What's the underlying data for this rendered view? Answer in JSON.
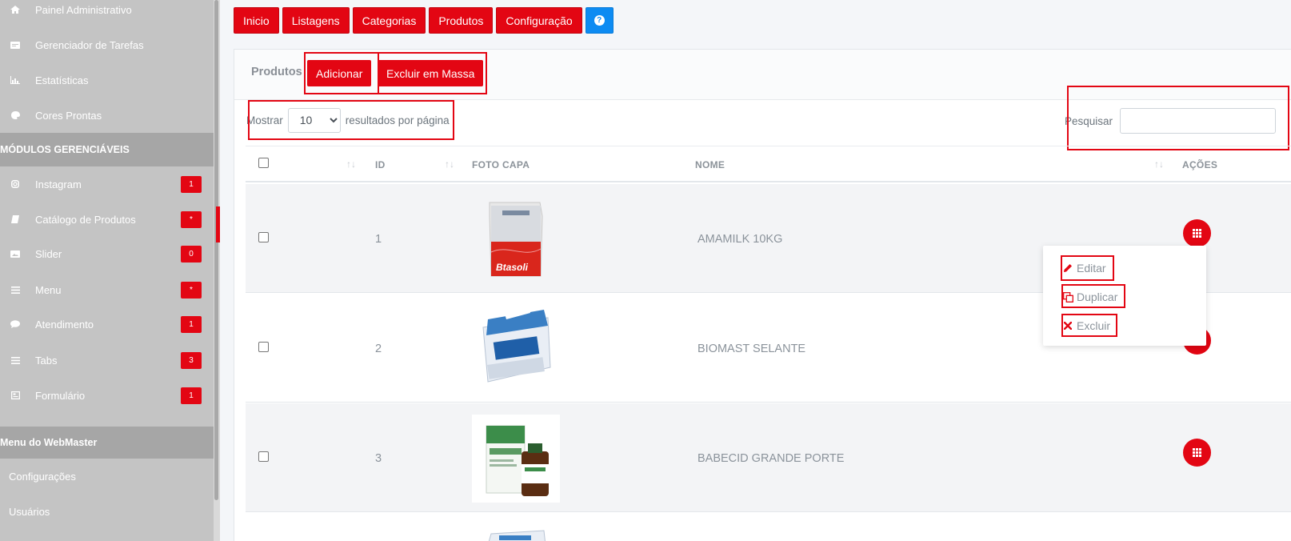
{
  "sidebar": {
    "items": [
      {
        "label": "Painel Administrativo",
        "icon": "home-icon"
      },
      {
        "label": "Gerenciador de Tarefas",
        "icon": "tasks-icon"
      },
      {
        "label": "Estatísticas",
        "icon": "chart-icon"
      },
      {
        "label": "Cores Prontas",
        "icon": "palette-icon"
      }
    ],
    "section_modules": "MÓDULOS GERENCIÁVEIS",
    "modules": [
      {
        "label": "Instagram",
        "badge": "1",
        "icon": "instagram-icon"
      },
      {
        "label": "Catálogo de Produtos",
        "badge": "*",
        "icon": "book-icon"
      },
      {
        "label": "Slider",
        "badge": "0",
        "icon": "image-icon"
      },
      {
        "label": "Menu",
        "badge": "*",
        "icon": "bars-icon"
      },
      {
        "label": "Atendimento",
        "badge": "1",
        "icon": "chat-icon"
      },
      {
        "label": "Tabs",
        "badge": "3",
        "icon": "list-icon"
      },
      {
        "label": "Formulário",
        "badge": "1",
        "icon": "form-icon"
      }
    ],
    "section_webmaster": "Menu do WebMaster",
    "webmaster": [
      {
        "label": "Configurações"
      },
      {
        "label": "Usuários"
      }
    ]
  },
  "topnav": {
    "buttons": [
      "Inicio",
      "Listagens",
      "Categorias",
      "Produtos",
      "Configuração"
    ],
    "help": "?"
  },
  "card": {
    "title": "Produtos",
    "add_label": "Adicionar",
    "bulk_delete_label": "Excluir em Massa"
  },
  "length": {
    "prefix": "Mostrar",
    "value": "10",
    "suffix": "resultados por página"
  },
  "search": {
    "label": "Pesquisar",
    "value": ""
  },
  "table": {
    "headers": {
      "id": "ID",
      "photo": "FOTO CAPA",
      "name": "NOME",
      "actions": "AÇÕES"
    },
    "rows": [
      {
        "id": "1",
        "name": "AMAMILK 10KG"
      },
      {
        "id": "2",
        "name": "BIOMAST SELANTE"
      },
      {
        "id": "3",
        "name": "BABECID GRANDE PORTE"
      }
    ]
  },
  "dropdown": {
    "edit": "Editar",
    "duplicate": "Duplicar",
    "delete": "Excluir"
  },
  "images": {
    "row1_brand": "Btasoli"
  },
  "colors": {
    "accent": "#e30613",
    "help": "#0d8bf2",
    "sidebar": "#c4c4c4",
    "sidebar_section": "#a6a6a6"
  }
}
